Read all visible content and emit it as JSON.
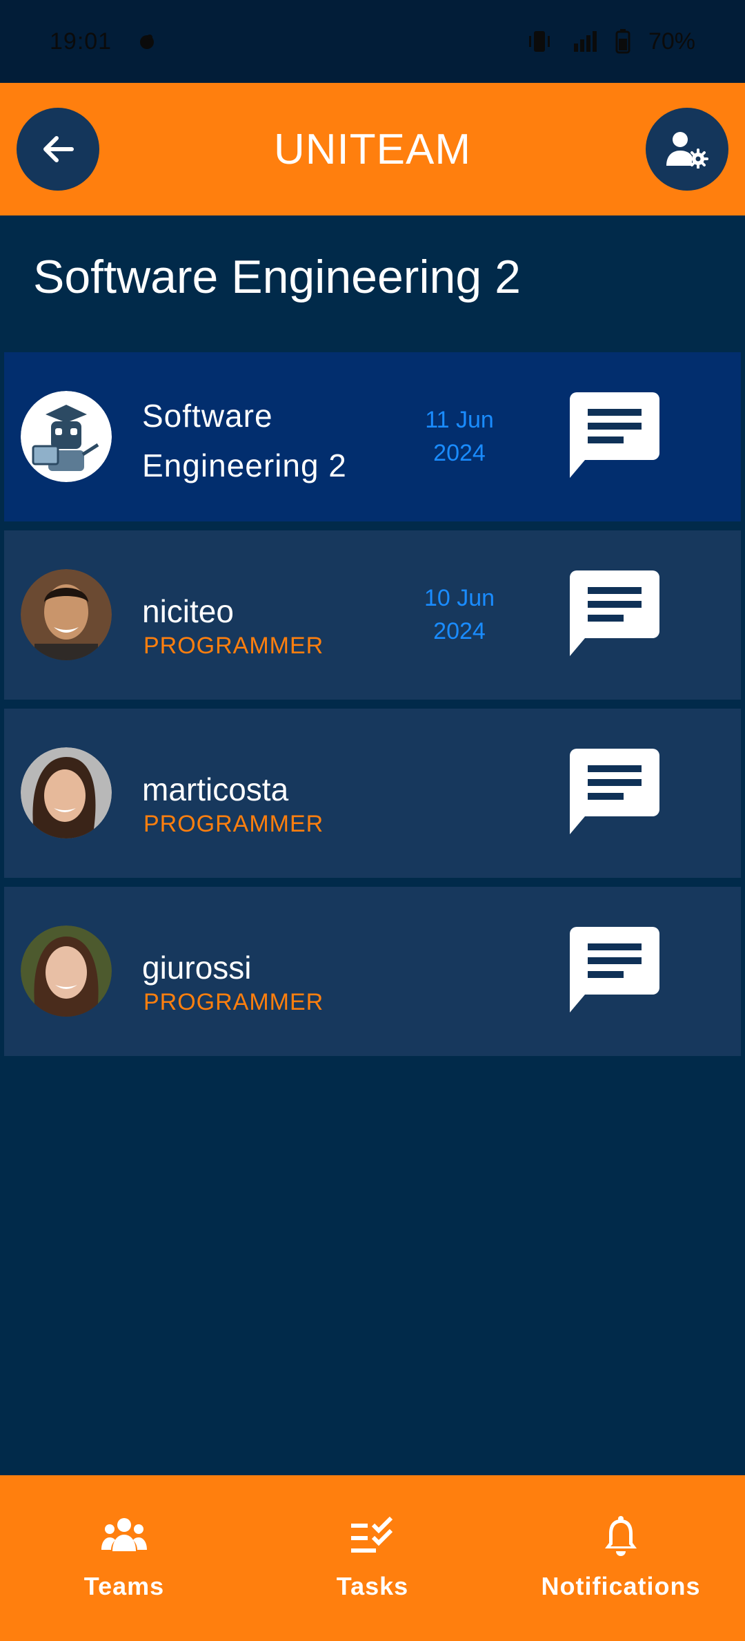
{
  "status_bar": {
    "time": "19:01",
    "battery": "70%"
  },
  "header": {
    "title": "UNITEAM"
  },
  "page": {
    "title": "Software Engineering 2"
  },
  "group_item": {
    "name_line1": "Software",
    "name_line2": "Engineering 2",
    "date_line1": "11 Jun",
    "date_line2": "2024"
  },
  "members": [
    {
      "name": "niciteo",
      "role": "PROGRAMMER",
      "date_line1": "10 Jun",
      "date_line2": "2024"
    },
    {
      "name": "marticosta",
      "role": "PROGRAMMER"
    },
    {
      "name": "giurossi",
      "role": "PROGRAMMER"
    }
  ],
  "nav": {
    "teams": "Teams",
    "tasks": "Tasks",
    "notifications": "Notifications"
  },
  "colors": {
    "accent": "#ff7f0e",
    "background": "#012a4a",
    "row": "#17385d",
    "active_row": "#022e6e",
    "date": "#1a8cff"
  }
}
